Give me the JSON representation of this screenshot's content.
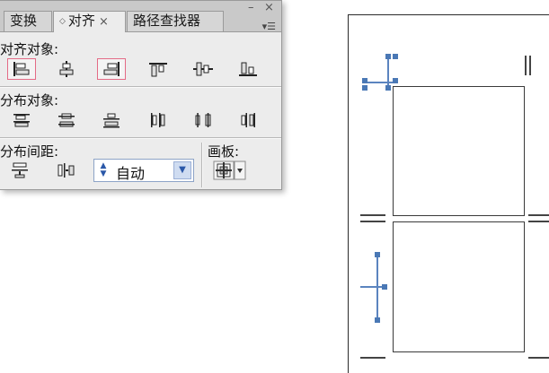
{
  "panel": {
    "tabs": [
      {
        "label": "变换",
        "active": false
      },
      {
        "label": "对齐",
        "active": true,
        "close": "×"
      },
      {
        "label": "路径查找器",
        "active": false
      }
    ],
    "window_controls": {
      "minimize": "–",
      "close": "×"
    },
    "menu_icon": "panel-menu-icon",
    "align_objects": {
      "label": "对齐对象:",
      "buttons": [
        {
          "name": "horizontal-align-left",
          "highlighted": true
        },
        {
          "name": "horizontal-align-center",
          "highlighted": false
        },
        {
          "name": "horizontal-align-right",
          "highlighted": true
        },
        {
          "name": "vertical-align-top",
          "highlighted": false
        },
        {
          "name": "vertical-align-center",
          "highlighted": false
        },
        {
          "name": "vertical-align-bottom",
          "highlighted": false
        }
      ]
    },
    "distribute_objects": {
      "label": "分布对象:",
      "buttons": [
        "vertical-distribute-top",
        "vertical-distribute-center",
        "vertical-distribute-bottom",
        "horizontal-distribute-left",
        "horizontal-distribute-center",
        "horizontal-distribute-right"
      ]
    },
    "distribute_spacing": {
      "label": "分布间距:",
      "buttons": [
        "vertical-distribute-space",
        "horizontal-distribute-space"
      ],
      "spacing_value": "自动"
    },
    "align_to": {
      "label": "画板:"
    }
  },
  "colors": {
    "highlight_border": "#e46b86",
    "selection_blue": "#4a78b5"
  }
}
